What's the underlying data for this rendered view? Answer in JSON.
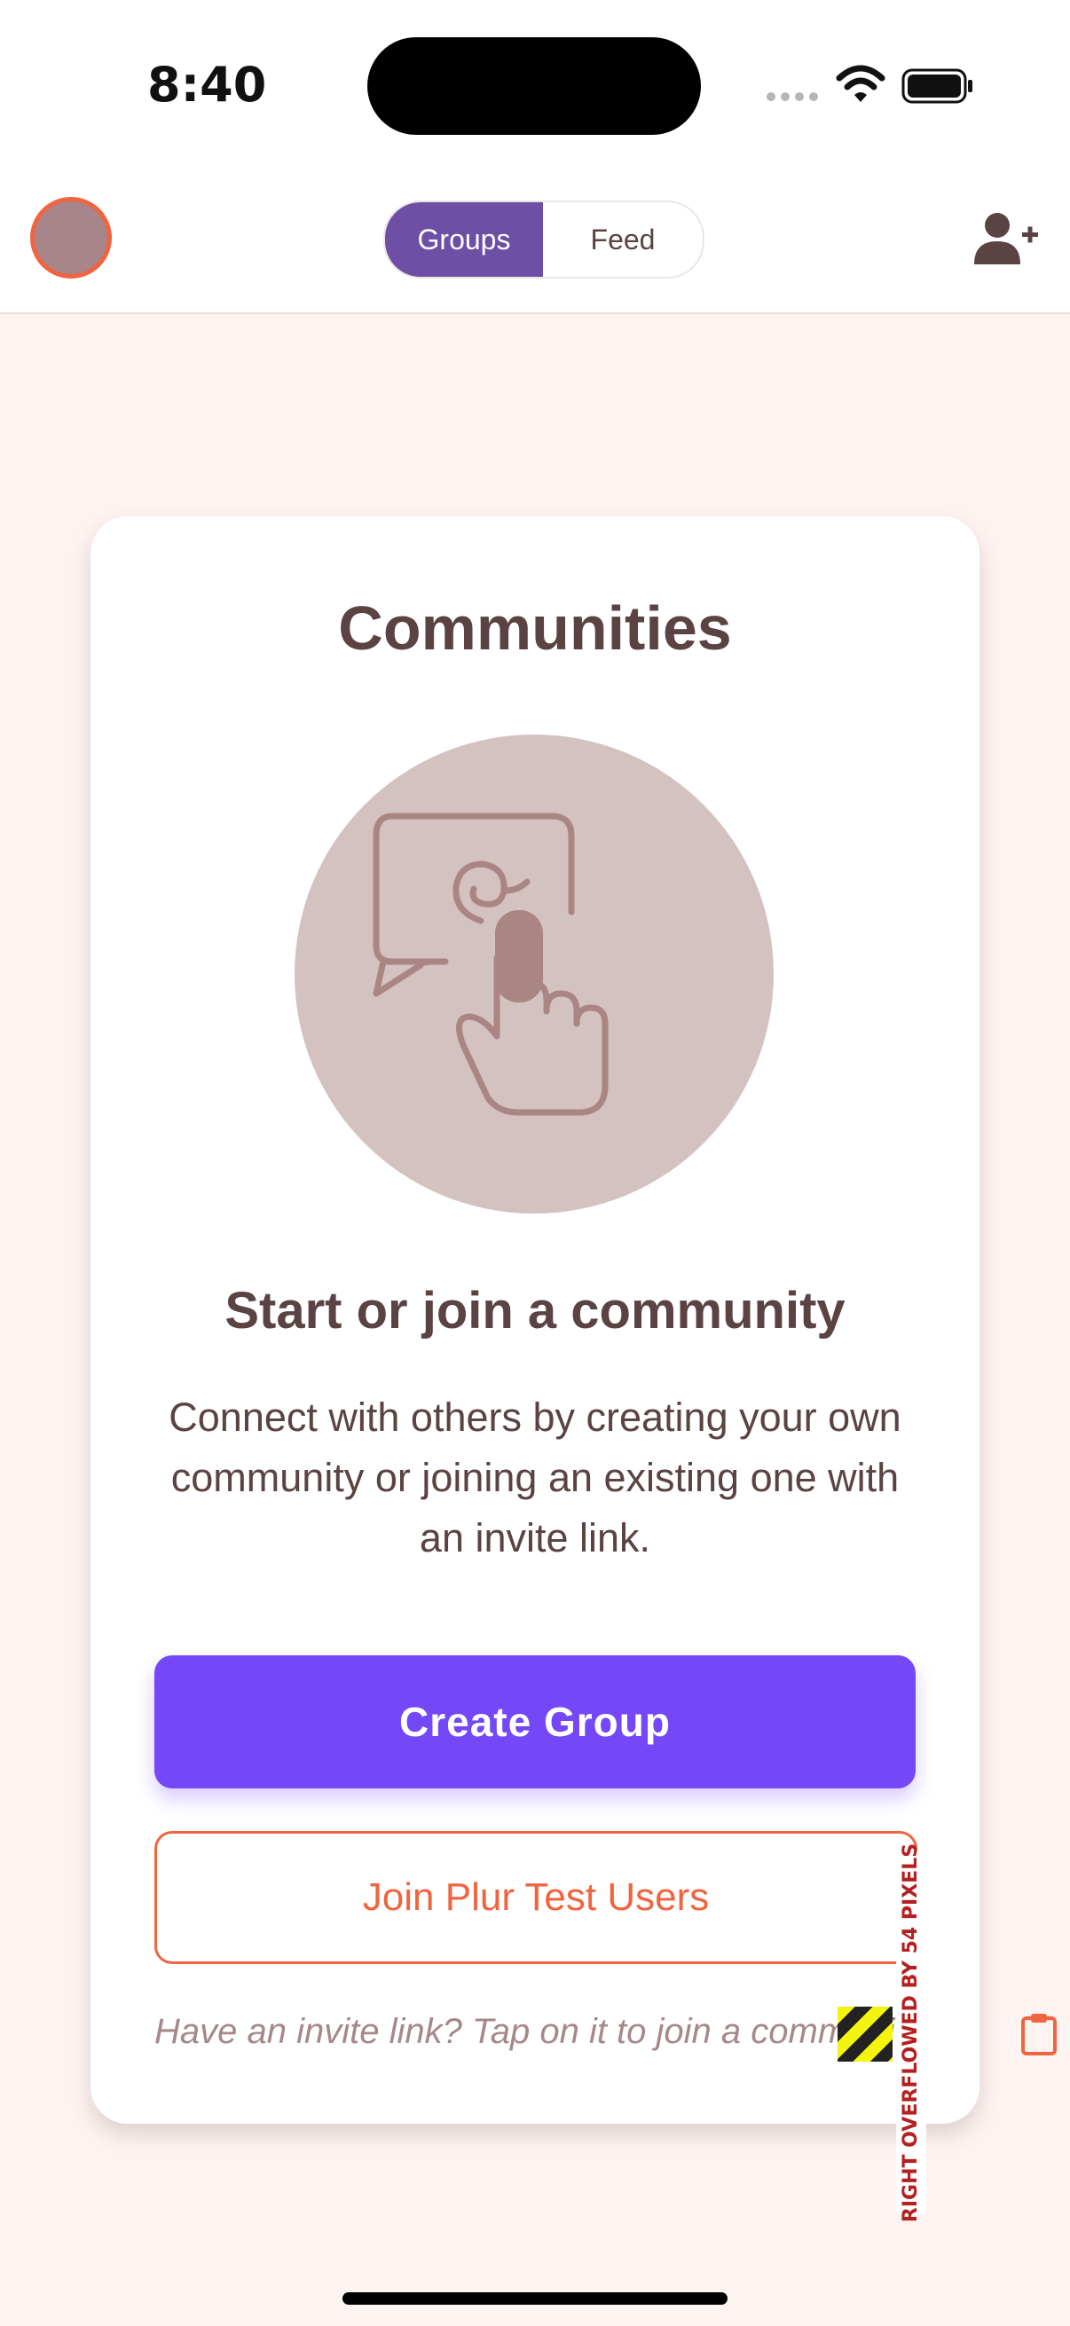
{
  "status_bar": {
    "time": "8:40"
  },
  "header": {
    "tabs": [
      {
        "label": "Groups",
        "active": true
      },
      {
        "label": "Feed",
        "active": false
      }
    ],
    "add_user_icon": "person-add-icon",
    "avatar_border_color": "#f0643f"
  },
  "card": {
    "title": "Communities",
    "illustration_icon": "chat-tap-icon",
    "subtitle": "Start or join a community",
    "description": "Connect with others by creating your own community or joining an existing one with an invite link.",
    "create_button_label": "Create Group",
    "join_button_label": "Join Plur Test Users",
    "invite_hint": "Have an invite link? Tap on it to join a community."
  },
  "debug": {
    "overflow_label": "RIGHT OVERFLOWED BY 54 PIXELS"
  },
  "colors": {
    "primary": "#7448f7",
    "segment_active": "#6e4fa6",
    "accent": "#f0643f",
    "text": "#5a4342",
    "background": "#fdf3f1"
  }
}
